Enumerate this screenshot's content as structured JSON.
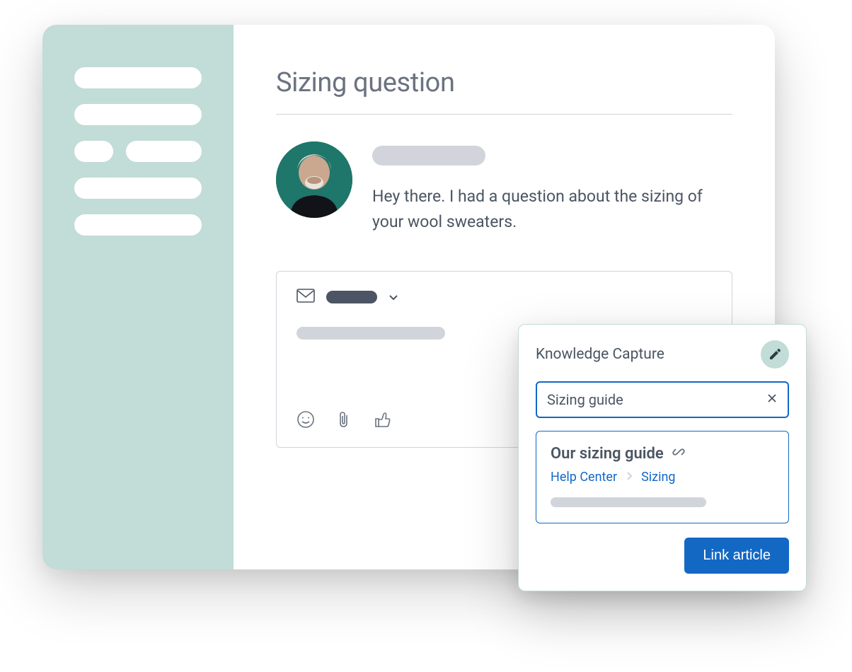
{
  "ticket": {
    "title": "Sizing question"
  },
  "message": {
    "body": "Hey there. I had a question about the sizing of your wool sweaters."
  },
  "knowledge_capture": {
    "title": "Knowledge Capture",
    "search_value": "Sizing guide",
    "result": {
      "title": "Our sizing guide",
      "breadcrumb_root": "Help Center",
      "breadcrumb_leaf": "Sizing"
    },
    "link_button": "Link article"
  }
}
